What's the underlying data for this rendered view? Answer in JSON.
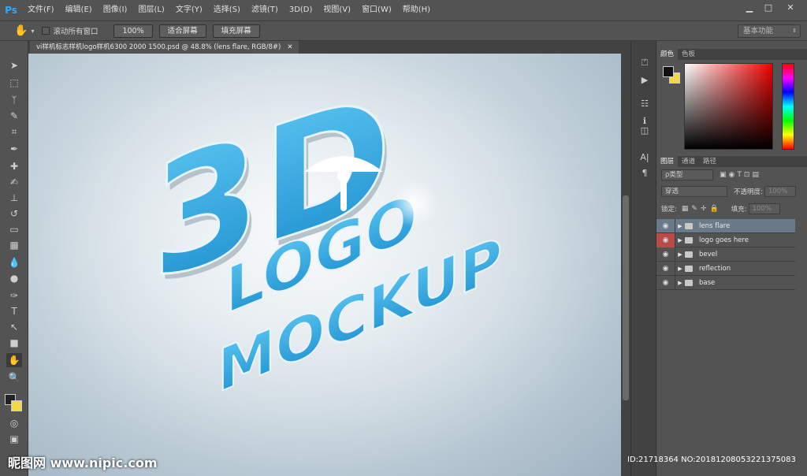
{
  "app": {
    "logo": "Ps"
  },
  "menu": [
    "文件(F)",
    "编辑(E)",
    "图像(I)",
    "图层(L)",
    "文字(Y)",
    "选择(S)",
    "滤镜(T)",
    "3D(D)",
    "视图(V)",
    "窗口(W)",
    "帮助(H)"
  ],
  "window_controls": {
    "minimize": "▁",
    "maximize": "□",
    "close": "✕"
  },
  "options": {
    "scroll_all_label": "滚动所有窗口",
    "zoom100": "100%",
    "fit_screen": "适合屏幕",
    "fill_screen": "填充屏幕",
    "workspace": "基本功能"
  },
  "document": {
    "tab_title": "vi样机标志样机logo样机6300 2000 1500.psd @ 48.8% (lens flare, RGB/8#)",
    "tab_close": "✕"
  },
  "artwork": {
    "line1": "3D",
    "line2": "LOGO",
    "line3": "MOCKUP"
  },
  "color_panel": {
    "tabs": [
      "颜色",
      "色板"
    ]
  },
  "layers_panel": {
    "tabs": [
      "图层",
      "通道",
      "路径"
    ],
    "filter_label": "ρ类型",
    "blend_mode": "穿透",
    "opacity_label": "不透明度:",
    "opacity_value": "100%",
    "lock_label": "锁定:",
    "fill_label": "填充:",
    "fill_value": "100%",
    "layers": [
      {
        "name": "lens flare",
        "selected": true
      },
      {
        "name": "logo goes here",
        "selected": false
      },
      {
        "name": "bevel",
        "selected": false
      },
      {
        "name": "reflection",
        "selected": false
      },
      {
        "name": "base",
        "selected": false
      }
    ]
  },
  "watermark": {
    "text": "昵图网 www.nipic.com",
    "id": "ID:21718364 NO:20181208053221375083"
  },
  "colors": {
    "accent": "#31a8ff",
    "logo_blue": "#29a3dc",
    "selected_layer": "#6a7a8a"
  }
}
